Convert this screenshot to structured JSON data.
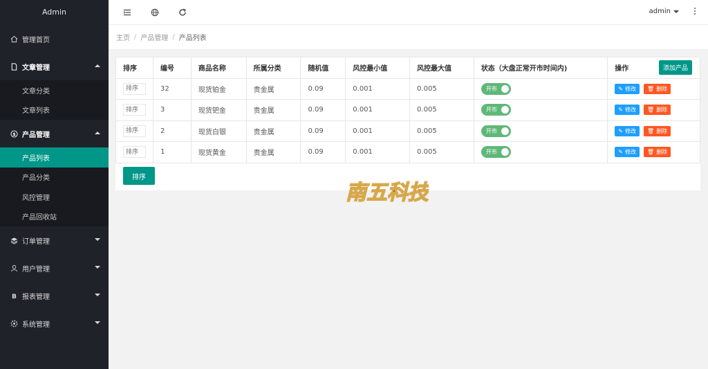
{
  "sidebar": {
    "brand": "Admin",
    "items": [
      {
        "label": "管理首页"
      },
      {
        "label": "文章管理",
        "children": [
          "文章分类",
          "文章列表"
        ]
      },
      {
        "label": "产品管理",
        "children": [
          "产品列表",
          "产品分类",
          "风控管理",
          "产品回收站"
        ]
      },
      {
        "label": "订单管理"
      },
      {
        "label": "用户管理"
      },
      {
        "label": "报表管理"
      },
      {
        "label": "系统管理"
      }
    ]
  },
  "topbar": {
    "user": "admin"
  },
  "breadcrumb": [
    "主页",
    "产品管理",
    "产品列表"
  ],
  "table": {
    "headers": [
      "排序",
      "编号",
      "商品名称",
      "所属分类",
      "随机值",
      "风控最小值",
      "风控最大值",
      "状态（大盘正常开市时间内)",
      "操作"
    ],
    "add_label": "添加产品",
    "sort_placeholder": "排序",
    "rows": [
      {
        "id": "32",
        "name": "现货铂金",
        "category": "贵金属",
        "random": "0.09",
        "min": "0.001",
        "max": "0.005",
        "status": "开市"
      },
      {
        "id": "3",
        "name": "现货钯金",
        "category": "贵金属",
        "random": "0.09",
        "min": "0.001",
        "max": "0.005",
        "status": "开市"
      },
      {
        "id": "2",
        "name": "现货白银",
        "category": "贵金属",
        "random": "0.09",
        "min": "0.001",
        "max": "0.005",
        "status": "开市"
      },
      {
        "id": "1",
        "name": "现货黄金",
        "category": "贵金属",
        "random": "0.09",
        "min": "0.001",
        "max": "0.005",
        "status": "开市"
      }
    ],
    "edit_label": "修改",
    "delete_label": "删除",
    "sort_button": "排序"
  },
  "watermark": {
    "text": "南五科技"
  },
  "colors": {
    "sidebar": "#20222a",
    "accent": "#009688",
    "edit": "#1e9fff",
    "delete": "#ff5722",
    "switch": "#5fb878"
  }
}
